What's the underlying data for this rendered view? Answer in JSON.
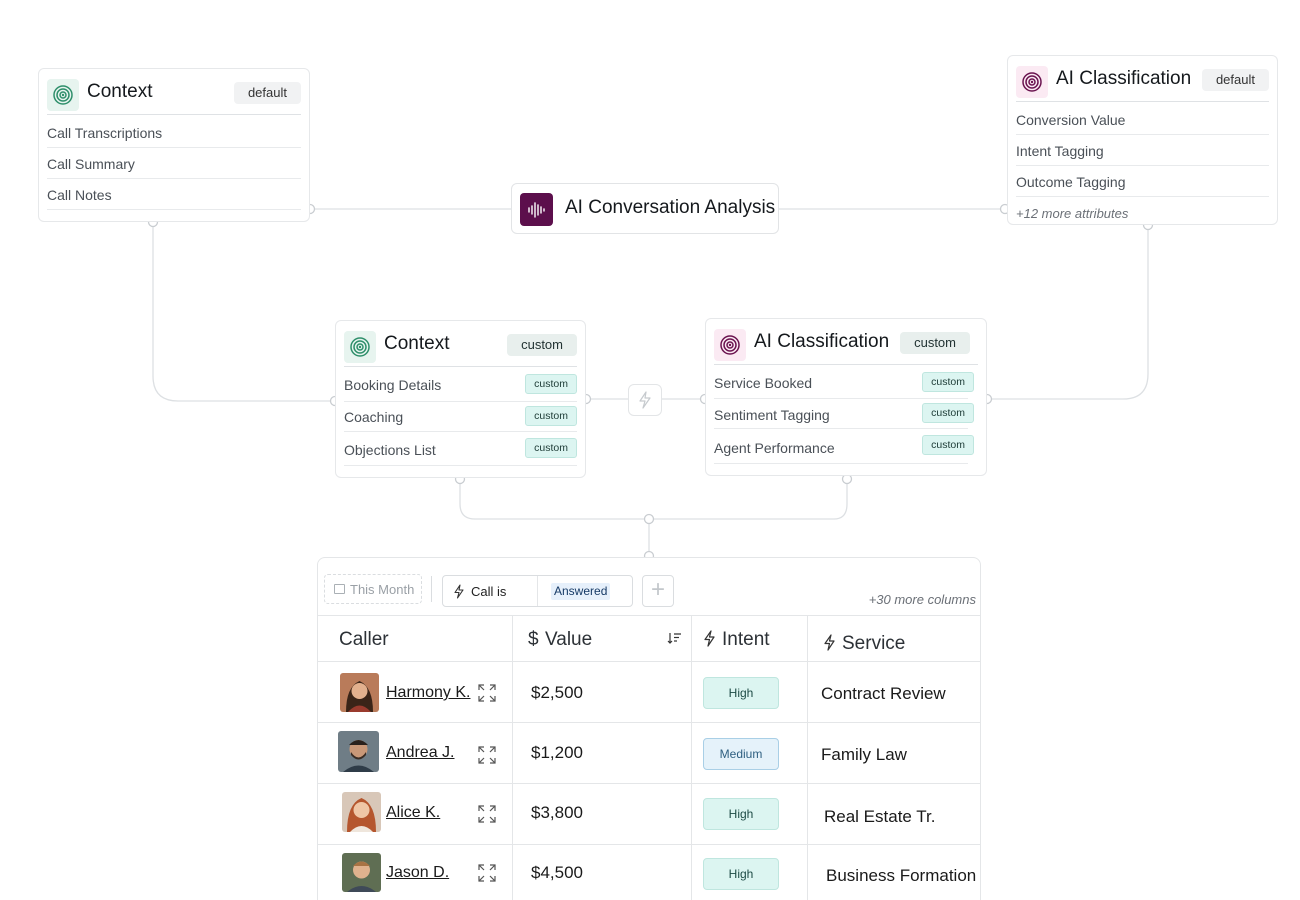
{
  "top_context": {
    "title": "Context",
    "tag": "default",
    "items": [
      "Call Transcriptions",
      "Call Summary",
      "Call Notes"
    ]
  },
  "top_classification": {
    "title": "AI Classification",
    "tag": "default",
    "items": [
      "Conversion Value",
      "Intent Tagging",
      "Outcome Tagging"
    ],
    "more": "+12 more attributes"
  },
  "analysis": {
    "title": "AI Conversation Analysis"
  },
  "mid_context": {
    "title": "Context",
    "tag": "custom",
    "items": [
      {
        "label": "Booking Details",
        "chip": "custom"
      },
      {
        "label": "Coaching",
        "chip": "custom"
      },
      {
        "label": "Objections List",
        "chip": "custom"
      }
    ]
  },
  "mid_classification": {
    "title": "AI Classification",
    "tag": "custom",
    "items": [
      {
        "label": "Service Booked",
        "chip": "custom"
      },
      {
        "label": "Sentiment Tagging",
        "chip": "custom"
      },
      {
        "label": "Agent Performance",
        "chip": "custom"
      }
    ]
  },
  "table": {
    "filters": {
      "date": "This Month",
      "condition": "Call is",
      "condition_value": "Answered",
      "add": "+"
    },
    "more_columns": "+30 more columns",
    "headers": {
      "caller": "Caller",
      "value": "Value",
      "value_prefix": "$",
      "intent": "Intent",
      "service": "Service"
    },
    "rows": [
      {
        "caller": "Harmony K.",
        "value": "$2,500",
        "intent": "High",
        "intent_level": "high",
        "service": "Contract Review"
      },
      {
        "caller": "Andrea J.",
        "value": "$1,200",
        "intent": "Medium",
        "intent_level": "medium",
        "service": "Family Law"
      },
      {
        "caller": "Alice K.",
        "value": "$3,800",
        "intent": "High",
        "intent_level": "high",
        "service": "Real Estate Tr."
      },
      {
        "caller": "Jason D.",
        "value": "$4,500",
        "intent": "High",
        "intent_level": "high",
        "service": "Business Formation"
      }
    ]
  },
  "colors": {
    "analysis_icon": "#5c0f4c",
    "context_icon": "#2f8f6b",
    "classification_icon": "#6b1450",
    "chip_bg": "#dcf5f1",
    "medium_bg": "#e5f2fa"
  },
  "icons": [
    "target-icon",
    "waveform-icon",
    "bolt-icon",
    "calendar-icon",
    "sort-icon",
    "expand-icon"
  ]
}
